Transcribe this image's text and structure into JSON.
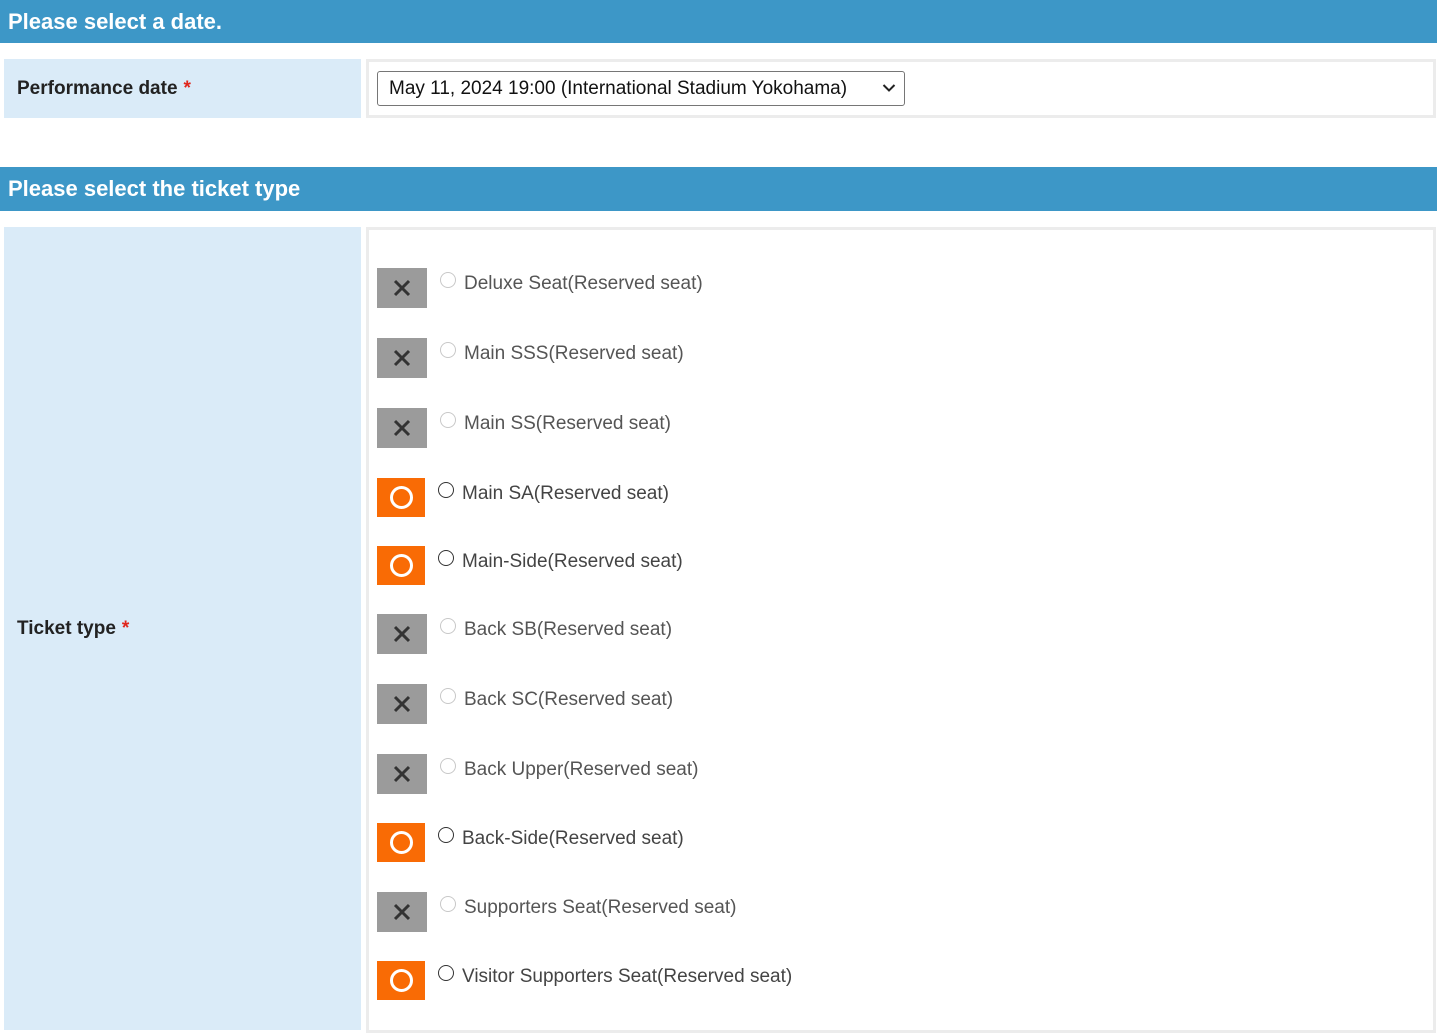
{
  "date_section": {
    "header": "Please select a date.",
    "field_label": "Performance date",
    "required_mark": "*",
    "selected_value": "May 11, 2024 19:00 (International Stadium Yokohama)"
  },
  "ticket_section": {
    "header": "Please select the ticket type",
    "field_label": "Ticket type",
    "required_mark": "*",
    "options": [
      {
        "label": "Deluxe Seat(Reserved seat)",
        "status": "unavailable",
        "status_icon": "cross-icon"
      },
      {
        "label": "Main SSS(Reserved seat)",
        "status": "unavailable",
        "status_icon": "cross-icon"
      },
      {
        "label": "Main SS(Reserved seat)",
        "status": "unavailable",
        "status_icon": "cross-icon"
      },
      {
        "label": "Main SA(Reserved seat)",
        "status": "available",
        "status_icon": "circle-icon"
      },
      {
        "label": "Main-Side(Reserved seat)",
        "status": "available",
        "status_icon": "circle-icon"
      },
      {
        "label": "Back SB(Reserved seat)",
        "status": "unavailable",
        "status_icon": "cross-icon"
      },
      {
        "label": "Back SC(Reserved seat)",
        "status": "unavailable",
        "status_icon": "cross-icon"
      },
      {
        "label": "Back Upper(Reserved seat)",
        "status": "unavailable",
        "status_icon": "cross-icon"
      },
      {
        "label": "Back-Side(Reserved seat)",
        "status": "available",
        "status_icon": "circle-icon"
      },
      {
        "label": "Supporters Seat(Reserved seat)",
        "status": "unavailable",
        "status_icon": "cross-icon"
      },
      {
        "label": "Visitor Supporters Seat(Reserved seat)",
        "status": "available",
        "status_icon": "circle-icon"
      }
    ]
  },
  "colors": {
    "header_bg": "#3d97c7",
    "label_bg": "#daebf8",
    "available": "#f96b05",
    "unavailable": "#9b9b9b",
    "required": "#e0261c"
  }
}
